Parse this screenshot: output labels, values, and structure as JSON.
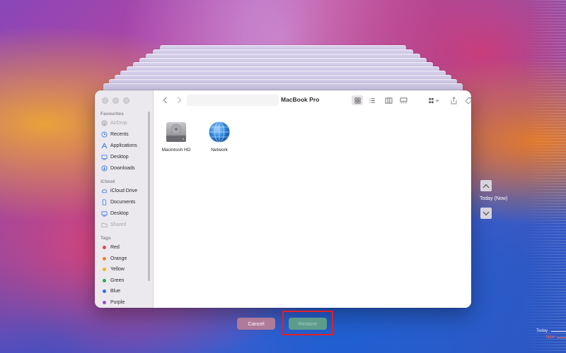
{
  "window": {
    "title": "MacBook Pro"
  },
  "sidebar": {
    "favourites_header": "Favourites",
    "favourites": [
      {
        "label": "AirDrop",
        "icon": "airdrop-icon",
        "dim": true
      },
      {
        "label": "Recents",
        "icon": "clock-icon"
      },
      {
        "label": "Applications",
        "icon": "applications-icon"
      },
      {
        "label": "Desktop",
        "icon": "desktop-icon"
      },
      {
        "label": "Downloads",
        "icon": "download-icon"
      }
    ],
    "icloud_header": "iCloud",
    "icloud": [
      {
        "label": "iCloud Drive",
        "icon": "cloud-icon"
      },
      {
        "label": "Documents",
        "icon": "document-icon"
      },
      {
        "label": "Desktop",
        "icon": "desktop-icon"
      },
      {
        "label": "Shared",
        "icon": "shared-folder-icon",
        "dim": true
      }
    ],
    "tags_header": "Tags",
    "tags": [
      {
        "label": "Red",
        "color": "#e5484d"
      },
      {
        "label": "Orange",
        "color": "#f0821e"
      },
      {
        "label": "Yellow",
        "color": "#e8b818"
      },
      {
        "label": "Green",
        "color": "#2dab4f"
      },
      {
        "label": "Blue",
        "color": "#2f6ff0"
      },
      {
        "label": "Purple",
        "color": "#9b4fc8"
      }
    ]
  },
  "files": [
    {
      "label": "Macintosh HD",
      "icon": "hard-drive-icon"
    },
    {
      "label": "Network",
      "icon": "network-globe-icon"
    }
  ],
  "buttons": {
    "cancel": "Cancel",
    "restore": "Restore"
  },
  "timeline": {
    "current": "Today (Now)",
    "today": "Today",
    "now": "Now"
  },
  "colors": {
    "accent": "#4a8fe6",
    "highlight": "#e0202a",
    "now": "#ff5a5a"
  }
}
